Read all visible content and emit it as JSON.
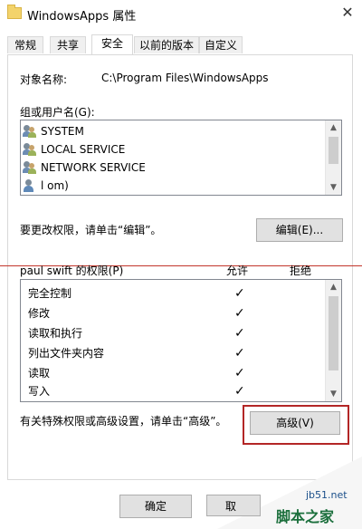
{
  "window": {
    "title": "WindowsApps 属性",
    "close_glyph": "✕"
  },
  "tabs": [
    {
      "label": "常规"
    },
    {
      "label": "共享"
    },
    {
      "label": "安全"
    },
    {
      "label": "以前的版本"
    },
    {
      "label": "自定义"
    }
  ],
  "object": {
    "label": "对象名称:",
    "value": "C:\\Program Files\\WindowsApps"
  },
  "groups": {
    "label": "组或用户名(G):",
    "items": [
      {
        "name": "SYSTEM",
        "icon": "group-icon"
      },
      {
        "name": "LOCAL SERVICE",
        "icon": "group-icon"
      },
      {
        "name": "NETWORK SERVICE",
        "icon": "group-icon"
      },
      {
        "name": "l                              om)",
        "icon": "user-icon"
      }
    ]
  },
  "edit_hint": "要更改权限，请单击“编辑”。",
  "edit_button": "编辑(E)...",
  "permissions": {
    "header": "paul swift 的权限(P)",
    "allow": "允许",
    "deny": "拒绝",
    "rows": [
      {
        "name": "完全控制",
        "allow": "✓"
      },
      {
        "name": "修改",
        "allow": "✓"
      },
      {
        "name": "读取和执行",
        "allow": "✓"
      },
      {
        "name": "列出文件夹内容",
        "allow": "✓"
      },
      {
        "name": "读取",
        "allow": "✓"
      },
      {
        "name": "写入",
        "allow": "✓"
      }
    ]
  },
  "advanced_hint": "有关特殊权限或高级设置，请单击“高级”。",
  "advanced_button": "高级(V)",
  "footer": {
    "ok": "确定",
    "cancel": "取"
  },
  "watermark": {
    "site": "jb51.net",
    "brand": "脚本之家"
  },
  "colors": {
    "highlight": "#b32626",
    "annotation_line": "#c2362b"
  }
}
